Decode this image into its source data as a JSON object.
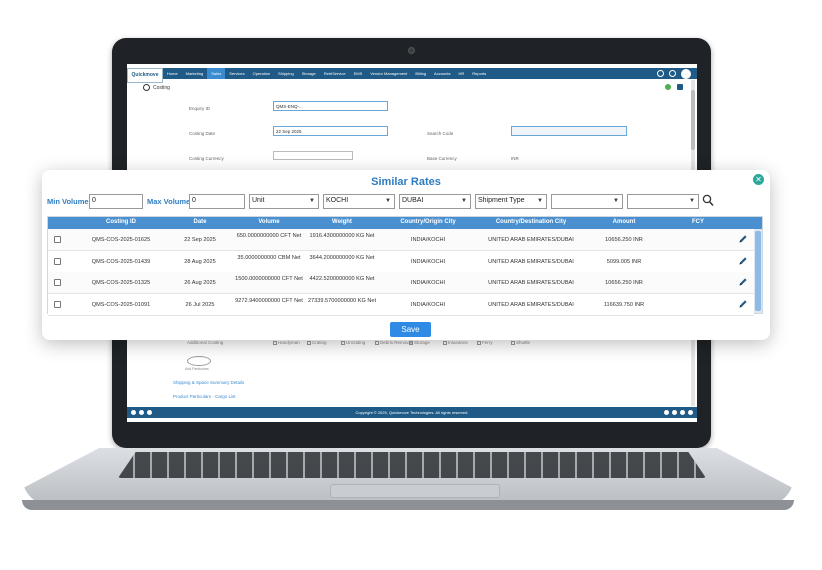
{
  "app": {
    "logo_text": "Quickmove",
    "nav": [
      "Home",
      "Marketing",
      "Sales",
      "Services",
      "Operation",
      "Shipping",
      "Storage",
      "RetriService",
      "EMS",
      "Vendor Management",
      "Billing",
      "Accounts",
      "HR",
      "Reports"
    ],
    "active_nav": "Sales",
    "page_title": "Costing",
    "form": {
      "enquiry_label": "Enquiry ID",
      "enquiry_value": "QMS-ENQ-...",
      "costing_date_label": "Costing Date",
      "costing_date_value": "22 Sep 2025",
      "costing_currency_label": "Costing Currency",
      "search_code_label": "Search Code",
      "base_currency_label": "Base Currency",
      "base_currency_value": "INR"
    },
    "lower": {
      "additional_costing_label": "Additional Costing",
      "checkbox_labels": [
        "Handyman",
        "Crating",
        "Uncrating",
        "Debris Removal",
        "Storage",
        "Insurance",
        "Ferry",
        "Shuttle"
      ],
      "add_label": "Add Particulars",
      "link1": "Shipping & Space Summary Details",
      "link2": "Product Particulars - Cargo List"
    },
    "footer_text": "Copyright © 2025, Quickmove Technologies. All rights reserved."
  },
  "modal": {
    "title": "Similar Rates",
    "filters": {
      "min_volume_label": "Min Volume",
      "min_volume_value": "0",
      "max_volume_label": "Max Volume",
      "max_volume_value": "0",
      "unit_value": "Unit",
      "origin_value": "KOCHI",
      "destination_value": "DUBAI",
      "shipment_type_value": "Shipment Type",
      "extra1_value": "",
      "extra2_value": ""
    },
    "columns": [
      "Costing ID",
      "Date",
      "Volume",
      "Weight",
      "Country/Origin City",
      "Country/Destination City",
      "Amount",
      "FCY"
    ],
    "rows": [
      {
        "id": "QMS-COS-2025-01625",
        "date": "22 Sep 2025",
        "volume": "650.0000000000 CFT Net",
        "weight": "1916.4300000000 KG Net",
        "origin": "INDIA/KOCHI",
        "destination": "UNITED ARAB EMIRATES/DUBAI",
        "amount": "10656.250 INR",
        "fcy": ""
      },
      {
        "id": "QMS-COS-2025-01439",
        "date": "28 Aug 2025",
        "volume": "35.0000000000 CBM Net",
        "weight": "3644.2000000000 KG Net",
        "origin": "INDIA/KOCHI",
        "destination": "UNITED ARAB EMIRATES/DUBAI",
        "amount": "5099.005 INR",
        "fcy": ""
      },
      {
        "id": "QMS-COS-2025-01325",
        "date": "26 Aug 2025",
        "volume": "1500.0000000000 CFT Net",
        "weight": "4422.5200000000 KG Net",
        "origin": "INDIA/KOCHI",
        "destination": "UNITED ARAB EMIRATES/DUBAI",
        "amount": "10656.250 INR",
        "fcy": ""
      },
      {
        "id": "QMS-COS-2025-01091",
        "date": "26 Jul 2025",
        "volume": "9272.9400000000 CFT Net",
        "weight": "27339.5700000000 KG Net",
        "origin": "INDIA/KOCHI",
        "destination": "UNITED ARAB EMIRATES/DUBAI",
        "amount": "116639.750 INR",
        "fcy": ""
      }
    ],
    "save_label": "Save",
    "close_icon": "close-icon",
    "search_icon": "search-icon",
    "edit_icon": "pencil-icon"
  },
  "colors": {
    "nav": "#1f5b86",
    "accent": "#2e7cc0",
    "header": "#4a90d0",
    "save": "#2f8ae6",
    "close": "#2aa89a"
  }
}
